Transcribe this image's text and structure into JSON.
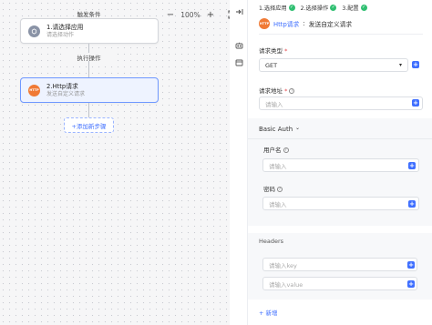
{
  "canvas": {
    "trigger_label": "触发条件",
    "action_label": "执行操作",
    "zoom_out": "−",
    "zoom_in": "+",
    "zoom_value": "100%",
    "nodes": [
      {
        "title": "1.请选择应用",
        "subtitle": "请选择动作",
        "icon": "app-icon"
      },
      {
        "title": "2.Http请求",
        "subtitle": "发送自定义请求",
        "icon": "http-icon"
      }
    ],
    "add_step": "+添加新步骤"
  },
  "toolbar": {
    "collapse_icon": "collapse-right-icon",
    "icons": [
      "robot-icon",
      "window-icon"
    ]
  },
  "panel": {
    "steps": [
      {
        "label": "1.选择应用",
        "done": true
      },
      {
        "label": "2.选择操作",
        "done": true
      },
      {
        "label": "3.配置",
        "done": true
      }
    ],
    "app_name": "Http请求",
    "app_sep": ":",
    "app_desc": "发送自定义请求",
    "app_icon_text": "HTTP",
    "method": {
      "label": "请求类型",
      "value": "GET"
    },
    "url": {
      "label": "请求地址",
      "placeholder": "请输入"
    },
    "auth": {
      "label": "Basic Auth",
      "username": {
        "label": "用户名",
        "placeholder": "请输入"
      },
      "password": {
        "label": "密码",
        "placeholder": "请输入"
      }
    },
    "headers": {
      "label": "Headers",
      "key_placeholder": "请输入key",
      "value_placeholder": "请输入value"
    },
    "new_label": "+ 新增"
  }
}
